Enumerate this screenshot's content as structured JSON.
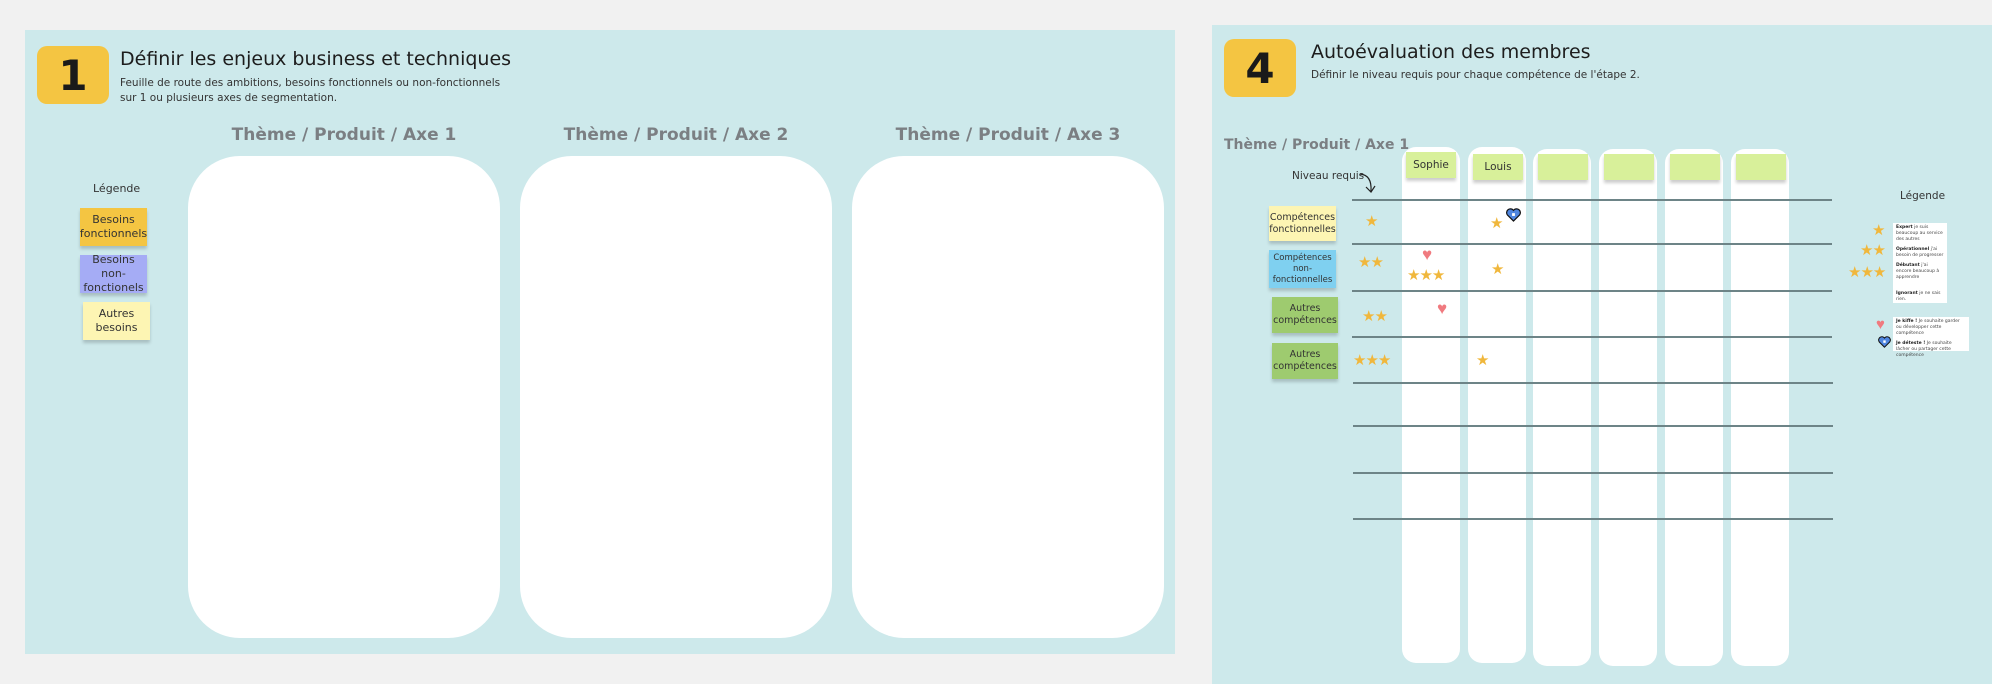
{
  "colors": {
    "frame_bg": "#cde9eb",
    "canvas_bg": "#f1f1f1",
    "badge": "#f4c542",
    "sticky_functional": "#f4c542",
    "sticky_nonfunctional": "#a5acf5",
    "sticky_other": "#fdf5b3",
    "member_note": "#d8f09a",
    "star": "#f0b73c",
    "heart_red": "#f07a7f",
    "heart_blue": "#4f86e0"
  },
  "step1": {
    "number": "1",
    "title": "Définir les enjeux business et techniques",
    "subtitle_line1": "Feuille de route des ambitions, besoins fonctionnels ou non-fonctionnels",
    "subtitle_line2": "sur 1 ou plusieurs axes de segmentation.",
    "legend_title": "Légende",
    "legend": [
      {
        "line1": "Besoins",
        "line2": "fonctionnels"
      },
      {
        "line1": "Besoins non-",
        "line2": "fonctionels"
      },
      {
        "line1": "Autres",
        "line2": "besoins"
      }
    ],
    "axes": [
      {
        "title": "Thème / Produit / Axe 1"
      },
      {
        "title": "Thème / Produit / Axe 2"
      },
      {
        "title": "Thème / Produit / Axe 3"
      }
    ]
  },
  "step4": {
    "number": "4",
    "title": "Autoévaluation des membres",
    "subtitle": "Définir le niveau requis pour chaque compétence de l'étape 2.",
    "axis_title": "Thème / Produit / Axe 1",
    "required_level_label": "Niveau requis",
    "members": [
      "Sophie",
      "Louis",
      "",
      "",
      "",
      ""
    ],
    "skills": [
      {
        "line1": "Compétences",
        "line2": "fonctionnelles",
        "line3": "",
        "required_stars": 1
      },
      {
        "line1": "Compétences",
        "line2": "non-",
        "line3": "fonctionnelles",
        "required_stars": 2
      },
      {
        "line1": "Autres",
        "line2": "compétences",
        "line3": "",
        "required_stars": 2
      },
      {
        "line1": "Autres",
        "line2": "compétences",
        "line3": "",
        "required_stars": 3
      }
    ],
    "ratings": [
      {
        "member": "Sophie",
        "skill": 1,
        "stars": 3,
        "heart": "love"
      },
      {
        "member": "Sophie",
        "skill": 2,
        "stars": 0,
        "heart": "love"
      },
      {
        "member": "Louis",
        "skill": 0,
        "stars": 1,
        "heart": "hate"
      },
      {
        "member": "Louis",
        "skill": 1,
        "stars": 1,
        "heart": ""
      },
      {
        "member": "Louis",
        "skill": 3,
        "stars": 1,
        "heart": ""
      }
    ],
    "legend_title": "Légende",
    "legend": {
      "levels": [
        {
          "stars": 1,
          "term": "Expert",
          "desc": "je suis beaucoup au service des autres"
        },
        {
          "stars": 2,
          "term": "Opérationnel",
          "desc": "j'ai besoin de progresser"
        },
        {
          "stars": 3,
          "term": "Débutant",
          "desc": "j'ai encore beaucoup à apprendre"
        },
        {
          "stars": 0,
          "term": "Ignorant",
          "desc": "je ne sais rien."
        }
      ],
      "love": {
        "term": "Je kiffe !",
        "desc": "Je souhaite garder ou développer cette compétence"
      },
      "hate": {
        "term": "Je déteste !",
        "desc": "Je souhaite lâcher ou partager cette compétence"
      }
    }
  }
}
